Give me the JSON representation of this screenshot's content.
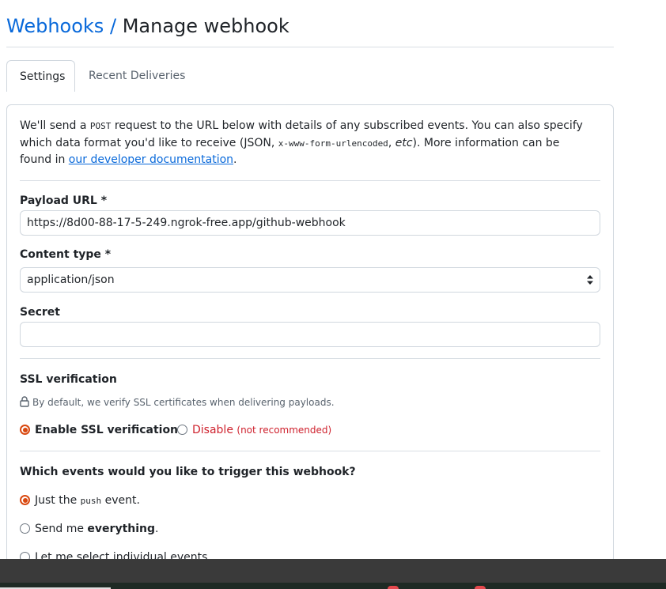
{
  "header": {
    "breadcrumb_link": "Webhooks",
    "breadcrumb_sep": "/",
    "title": "Manage webhook"
  },
  "tabs": [
    {
      "label": "Settings"
    },
    {
      "label": "Recent Deliveries"
    }
  ],
  "intro": {
    "part1": "We'll send a ",
    "code1": "POST",
    "part2": " request to the URL below with details of any subscribed events. You can also specify which data format you'd like to receive (JSON, ",
    "code2": "x-www-form-urlencoded",
    "part3": ", ",
    "etc": "etc",
    "part4": "). More information can be found in ",
    "link": "our developer documentation",
    "part5": "."
  },
  "form": {
    "payload_label": "Payload URL *",
    "payload_value": "https://8d00-88-17-5-249.ngrok-free.app/github-webhook",
    "content_type_label": "Content type *",
    "content_type_value": "application/json",
    "secret_label": "Secret",
    "secret_value": ""
  },
  "ssl": {
    "heading": "SSL verification",
    "note": "By default, we verify SSL certificates when delivering payloads.",
    "enable_label": "Enable SSL verification",
    "disable_label": "Disable",
    "disable_note": "(not recommended)"
  },
  "events": {
    "heading": "Which events would you like to trigger this webhook?",
    "opt1_pre": "Just the ",
    "opt1_code": "push",
    "opt1_post": " event.",
    "opt2_pre": "Send me ",
    "opt2_bold": "everything",
    "opt2_post": ".",
    "opt3": "Let me select individual events."
  },
  "colors": {
    "link": "#0969da",
    "accent_radio": "#d9480f",
    "danger": "#cf222e"
  },
  "icons": [
    "lock-icon",
    "select-arrows-icon"
  ]
}
